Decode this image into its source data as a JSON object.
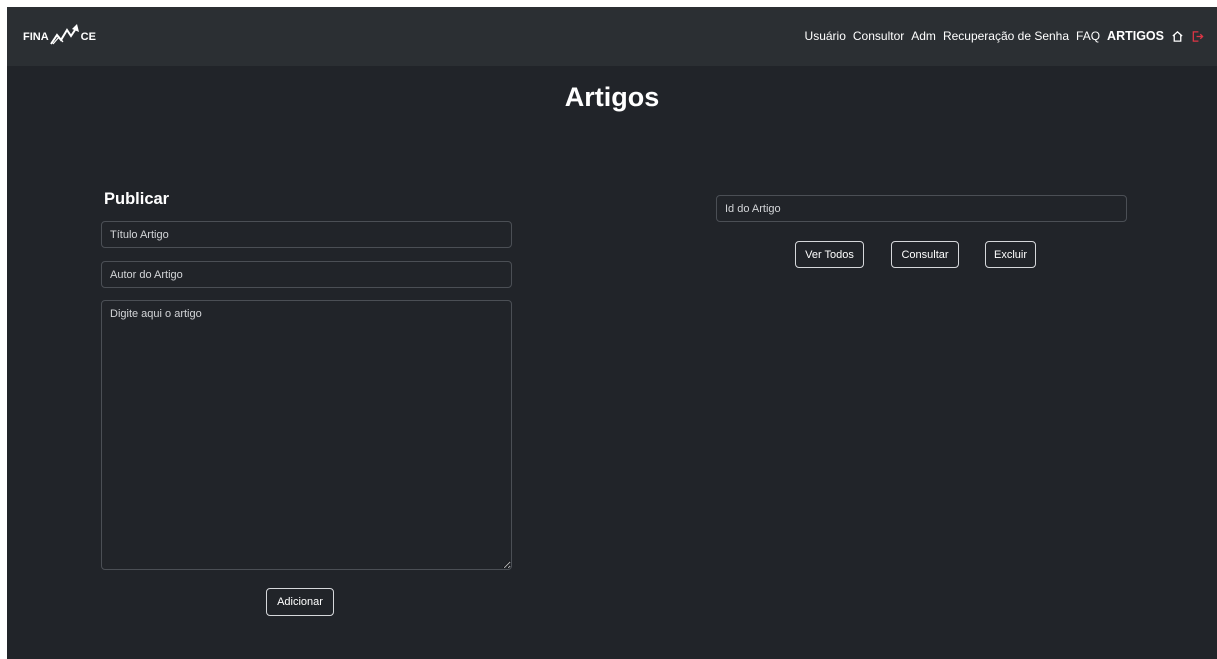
{
  "brand": {
    "logo_left": "FINA",
    "logo_right": "CE",
    "logo_icon": "trend-arrow-icon"
  },
  "nav": {
    "items": [
      {
        "label": "Usuário"
      },
      {
        "label": "Consultor"
      },
      {
        "label": "Adm"
      },
      {
        "label": "Recuperação de Senha"
      },
      {
        "label": "FAQ"
      },
      {
        "label": "ARTIGOS"
      }
    ],
    "home_icon": "home-icon",
    "logout_icon": "logout-icon",
    "logout_color": "#dc3545"
  },
  "page": {
    "title": "Artigos"
  },
  "publish": {
    "heading": "Publicar",
    "title_placeholder": "Título Artigo",
    "author_placeholder": "Autor do Artigo",
    "body_placeholder": "Digite aqui o artigo",
    "add_label": "Adicionar"
  },
  "query": {
    "id_placeholder": "Id do Artigo",
    "view_all_label": "Ver Todos",
    "consult_label": "Consultar",
    "delete_label": "Excluir"
  },
  "colors": {
    "background": "#212429",
    "navbar": "#2b2f33",
    "text": "#ffffff"
  }
}
